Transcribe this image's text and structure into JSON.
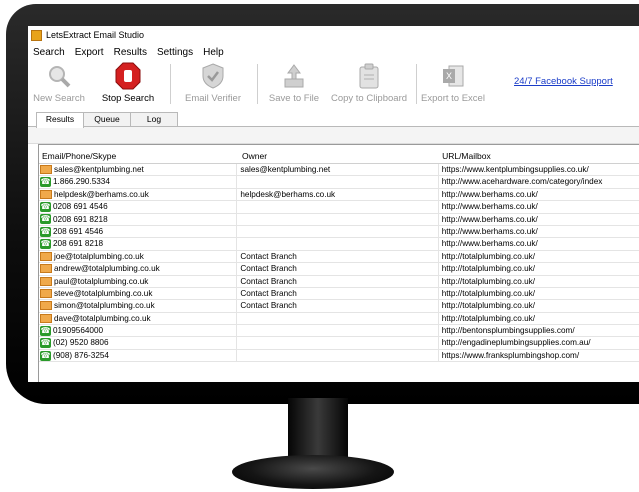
{
  "window": {
    "title": "LetsExtract Email Studio"
  },
  "menu": [
    "Search",
    "Export",
    "Results",
    "Settings",
    "Help"
  ],
  "toolbar": {
    "new_search": "New Search",
    "stop_search": "Stop Search",
    "email_verifier": "Email Verifier",
    "save_to_file": "Save to File",
    "copy_to_clipboard": "Copy to Clipboard",
    "export_to_excel": "Export to Excel",
    "facebook_support": "24/7 Facebook Support"
  },
  "tabs": [
    "Results",
    "Queue",
    "Log"
  ],
  "table": {
    "headers": [
      "Email/Phone/Skype",
      "Owner",
      "URL/Mailbox"
    ],
    "rows": [
      {
        "type": "email",
        "value": "sales@kentplumbing.net",
        "owner": "sales@kentplumbing.net",
        "url": "https://www.kentplumbingsupplies.co.uk/"
      },
      {
        "type": "phone",
        "value": "1.866.290.5334",
        "owner": "",
        "url": "http://www.acehardware.com/category/index"
      },
      {
        "type": "email",
        "value": "helpdesk@berhams.co.uk",
        "owner": "helpdesk@berhams.co.uk",
        "url": "http://www.berhams.co.uk/"
      },
      {
        "type": "phone",
        "value": "0208 691 4546",
        "owner": "",
        "url": "http://www.berhams.co.uk/"
      },
      {
        "type": "phone",
        "value": "0208 691 8218",
        "owner": "",
        "url": "http://www.berhams.co.uk/"
      },
      {
        "type": "phone",
        "value": "208 691 4546",
        "owner": "",
        "url": "http://www.berhams.co.uk/"
      },
      {
        "type": "phone",
        "value": "208 691 8218",
        "owner": "",
        "url": "http://www.berhams.co.uk/"
      },
      {
        "type": "email",
        "value": "joe@totalplumbing.co.uk",
        "owner": "Contact Branch",
        "url": "http://totalplumbing.co.uk/"
      },
      {
        "type": "email",
        "value": "andrew@totalplumbing.co.uk",
        "owner": "Contact Branch",
        "url": "http://totalplumbing.co.uk/"
      },
      {
        "type": "email",
        "value": "paul@totalplumbing.co.uk",
        "owner": "Contact Branch",
        "url": "http://totalplumbing.co.uk/"
      },
      {
        "type": "email",
        "value": "steve@totalplumbing.co.uk",
        "owner": "Contact Branch",
        "url": "http://totalplumbing.co.uk/"
      },
      {
        "type": "email",
        "value": "simon@totalplumbing.co.uk",
        "owner": "Contact Branch",
        "url": "http://totalplumbing.co.uk/"
      },
      {
        "type": "email",
        "value": "dave@totalplumbing.co.uk",
        "owner": "",
        "url": "http://totalplumbing.co.uk/"
      },
      {
        "type": "phone",
        "value": "01909564000",
        "owner": "",
        "url": "http://bentonsplumbingsupplies.com/"
      },
      {
        "type": "phone",
        "value": "(02) 9520 8806",
        "owner": "",
        "url": "http://engadineplumbingsupplies.com.au/"
      },
      {
        "type": "phone",
        "value": "(908) 876-3254",
        "owner": "",
        "url": "https://www.franksplumbingshop.com/"
      }
    ]
  }
}
